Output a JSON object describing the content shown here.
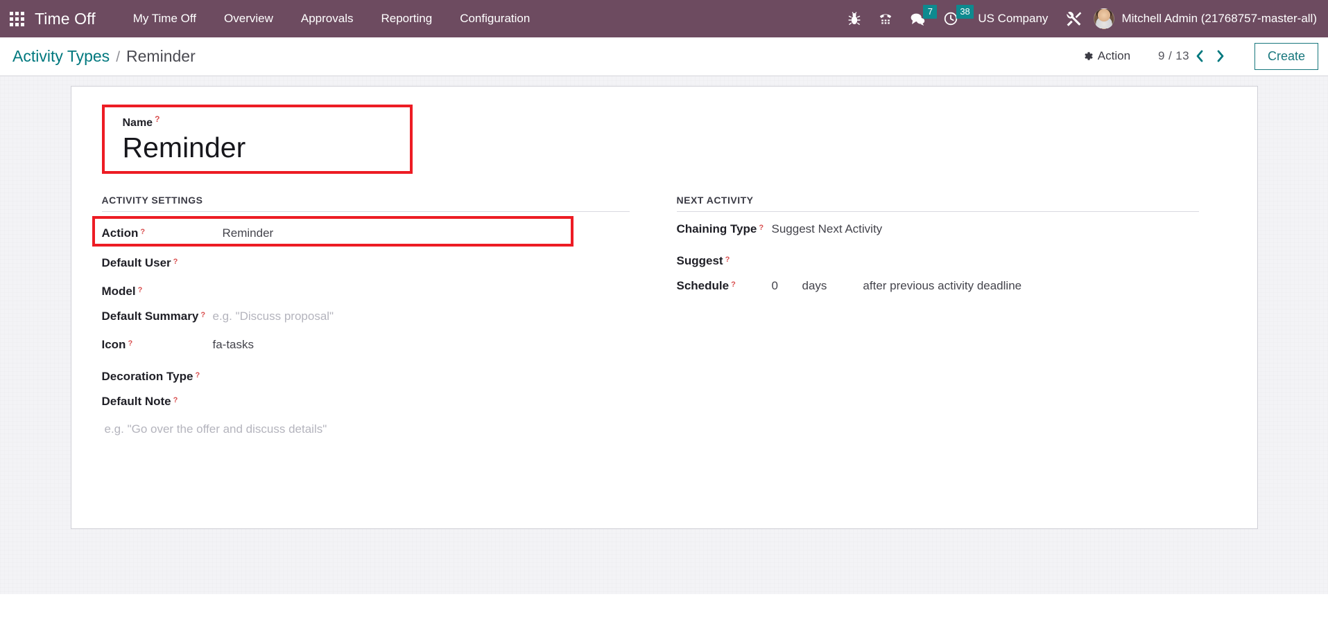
{
  "navbar": {
    "apps_icon": "apps-grid-icon",
    "brand": "Time Off",
    "menu": [
      {
        "label": "My Time Off"
      },
      {
        "label": "Overview"
      },
      {
        "label": "Approvals"
      },
      {
        "label": "Reporting"
      },
      {
        "label": "Configuration"
      }
    ],
    "systray": {
      "bug_icon": "bug-icon",
      "phone_icon": "phone-dialpad-icon",
      "messages_icon": "chat-bubbles-icon",
      "messages_count": "7",
      "activities_icon": "clock-icon",
      "activities_count": "38",
      "company": "US Company",
      "tools_icon": "tools-icon",
      "avatar_icon": "user-avatar",
      "user": "Mitchell Admin (21768757-master-all)"
    },
    "badge_color": "#0E8A8F",
    "bar_color": "#6D4B60"
  },
  "control_panel": {
    "breadcrumb_parent": "Activity Types",
    "breadcrumb_separator": "/",
    "breadcrumb_current": "Reminder",
    "action_label": "Action",
    "action_icon": "gear-icon",
    "pager": "9 / 13",
    "prev_icon": "chevron-left-icon",
    "next_icon": "chevron-right-icon",
    "create_label": "Create",
    "accent_color": "#00787E"
  },
  "form": {
    "title": {
      "label": "Name",
      "help": "?",
      "value": "Reminder",
      "highlighted": true
    },
    "left_group": {
      "title": "Activity Settings",
      "fields": [
        {
          "label": "Action",
          "help": "?",
          "value": "Reminder",
          "highlighted": true
        },
        {
          "label": "Default User",
          "help": "?",
          "value": ""
        },
        {
          "label": "Model",
          "help": "?",
          "value": ""
        },
        {
          "label": "Default Summary",
          "help": "?",
          "value": "",
          "placeholder": "e.g. \"Discuss proposal\""
        },
        {
          "label": "Icon",
          "help": "?",
          "value": "fa-tasks"
        },
        {
          "label": "Decoration Type",
          "help": "?",
          "value": ""
        },
        {
          "label": "Default Note",
          "help": "?",
          "value": ""
        }
      ],
      "note_placeholder": "e.g. \"Go over the offer and discuss details\""
    },
    "right_group": {
      "title": "Next Activity",
      "fields": [
        {
          "label": "Chaining Type",
          "help": "?",
          "value": "Suggest Next Activity"
        },
        {
          "label": "Suggest",
          "help": "?",
          "value": ""
        }
      ],
      "schedule": {
        "label": "Schedule",
        "help": "?",
        "amount": "0",
        "unit": "days",
        "trigger": "after previous activity deadline"
      }
    },
    "highlight_color": "#ED1C24"
  }
}
